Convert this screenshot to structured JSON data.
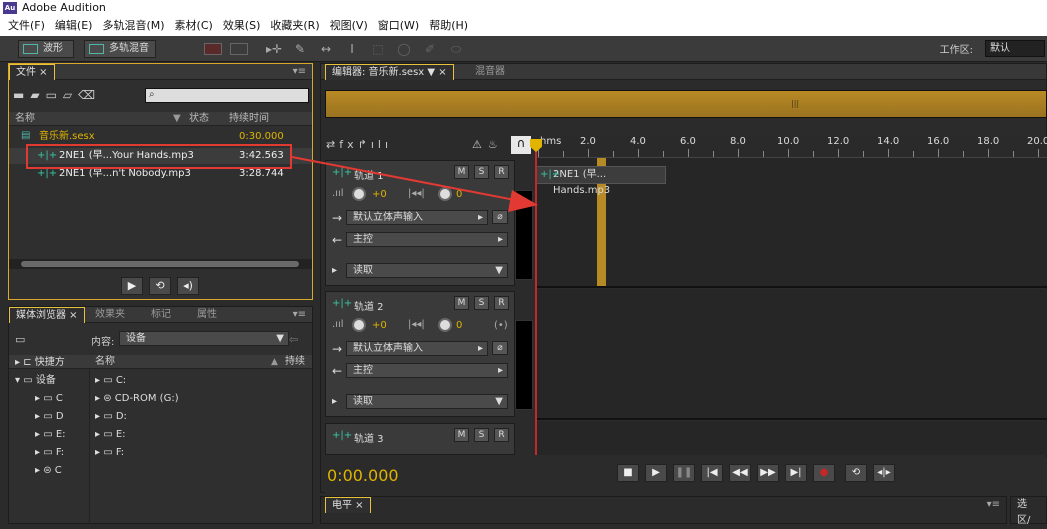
{
  "app": {
    "title": "Adobe Audition",
    "logo": "Au"
  },
  "menu": [
    "文件(F)",
    "编辑(E)",
    "多轨混音(M)",
    "素材(C)",
    "效果(S)",
    "收藏夹(R)",
    "视图(V)",
    "窗口(W)",
    "帮助(H)"
  ],
  "toolbar": {
    "waveform_label": "波形",
    "multitrack_label": "多轨混音",
    "workspace_label": "工作区:",
    "workspace_value": "默认"
  },
  "files_panel": {
    "tab": "文件",
    "columns": {
      "name": "名称",
      "status": "状态",
      "duration": "持续时间"
    },
    "rows": [
      {
        "name": "音乐新.sesx",
        "duration": "0:30.000",
        "kind": "session"
      },
      {
        "name": "2NE1 (早...Your Hands.mp3",
        "duration": "3:42.563",
        "kind": "audio"
      },
      {
        "name": "2NE1 (早...n't Nobody.mp3",
        "duration": "3:28.744",
        "kind": "audio"
      }
    ]
  },
  "media_panel": {
    "tabs": [
      "媒体浏览器",
      "效果夹",
      "标记",
      "属性"
    ],
    "content_label": "内容:",
    "content_value": "设备",
    "name_header": "名称",
    "duration_header": "持续",
    "tree_left": [
      "快捷方",
      "设备",
      "C",
      "D",
      "E:",
      "F:",
      "C"
    ],
    "drives": [
      "C:",
      "CD-ROM (G:)",
      "D:",
      "E:",
      "F:"
    ]
  },
  "editor": {
    "tab": "编辑器: 音乐新.sesx",
    "tab2": "混音器",
    "ruler_unit": "hms",
    "ruler_ticks": [
      "2.0",
      "4.0",
      "6.0",
      "8.0",
      "10.0",
      "12.0",
      "14.0",
      "16.0",
      "18.0",
      "20.0"
    ],
    "clip_label": "2NE1 (早... Hands.mp3",
    "tracks": [
      {
        "name": "轨道 1",
        "vol": "+0",
        "pan": "0",
        "input": "默认立体声输入",
        "output": "主控",
        "mode": "读取"
      },
      {
        "name": "轨道 2",
        "vol": "+0",
        "pan": "0",
        "input": "默认立体声输入",
        "output": "主控",
        "mode": "读取"
      },
      {
        "name": "轨道 3"
      }
    ],
    "mute": "M",
    "solo": "S",
    "record": "R",
    "timecode": "0:00.000"
  },
  "bottom": {
    "level_tab": "电平",
    "selection_tab": "选区/"
  }
}
